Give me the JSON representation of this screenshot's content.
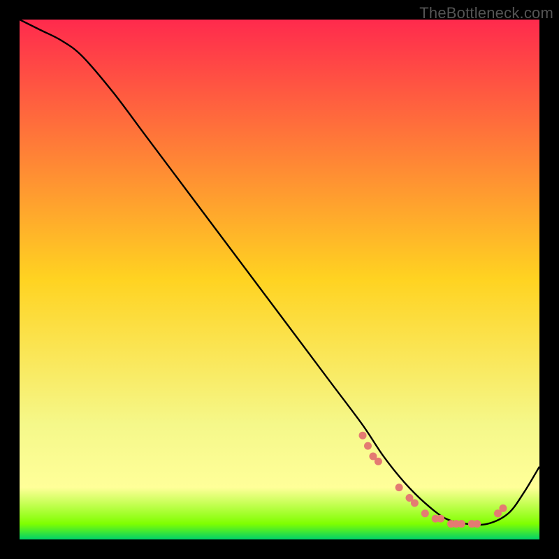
{
  "watermark": "TheBottleneck.com",
  "chart_data": {
    "type": "line",
    "title": "",
    "xlabel": "",
    "ylabel": "",
    "xlim": [
      0,
      100
    ],
    "ylim": [
      0,
      100
    ],
    "grid": false,
    "legend": false,
    "background_gradient": {
      "stops": [
        {
          "offset": 0.0,
          "color": "#ff2a4d"
        },
        {
          "offset": 0.5,
          "color": "#ffd321"
        },
        {
          "offset": 0.78,
          "color": "#f5f88a"
        },
        {
          "offset": 0.9,
          "color": "#ffff99"
        },
        {
          "offset": 0.97,
          "color": "#7fff00"
        },
        {
          "offset": 1.0,
          "color": "#00d169"
        }
      ]
    },
    "series": [
      {
        "name": "bottleneck-curve",
        "color": "#000000",
        "x": [
          0,
          4,
          8,
          12,
          18,
          24,
          30,
          36,
          42,
          48,
          54,
          60,
          66,
          70,
          74,
          78,
          82,
          86,
          90,
          94,
          97,
          100
        ],
        "y": [
          100,
          98,
          96,
          93,
          86,
          78,
          70,
          62,
          54,
          46,
          38,
          30,
          22,
          16,
          11,
          7,
          4,
          3,
          3,
          5,
          9,
          14
        ]
      }
    ],
    "markers": {
      "name": "scatter-points",
      "color": "#e47a72",
      "x": [
        66,
        67,
        68,
        69,
        73,
        75,
        76,
        78,
        80,
        81,
        83,
        84,
        85,
        87,
        88,
        92,
        93
      ],
      "y": [
        20,
        18,
        16,
        15,
        10,
        8,
        7,
        5,
        4,
        4,
        3,
        3,
        3,
        3,
        3,
        5,
        6
      ]
    }
  }
}
